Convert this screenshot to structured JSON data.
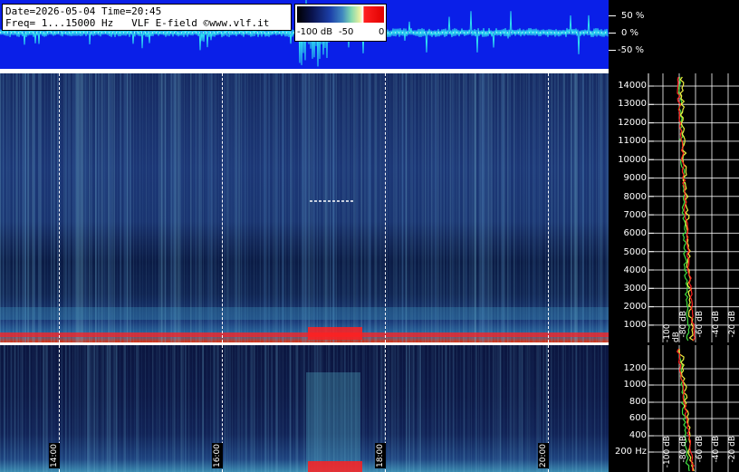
{
  "header": {
    "date_time": "Date=2026-05-04 Time=20:45",
    "freq": "Freq= 1...15000 Hz   VLF E-field ©www.vlf.it"
  },
  "colorbar": {
    "ticks": [
      "-100 dB",
      "-50",
      "0"
    ]
  },
  "waveform_scale": [
    "50 %",
    "0 %",
    "-50 %"
  ],
  "time_axis": [
    "14:00",
    "16:00",
    "18:00",
    "20:00"
  ],
  "top_panel": {
    "freq_labels": [
      "14000",
      "13000",
      "12000",
      "11000",
      "10000",
      "9000",
      "8000",
      "7000",
      "6000",
      "5000",
      "4000",
      "3000",
      "2000",
      "1000"
    ],
    "db_labels": [
      "-100 dB",
      "-80 dB",
      "-60 dB",
      "-40 dB",
      "-20 dB"
    ]
  },
  "bottom_panel": {
    "freq_labels": [
      "1200",
      "1000",
      "800",
      "600",
      "400",
      "200 Hz"
    ],
    "db_labels": [
      "-100 dB",
      "-80 dB",
      "-60 dB",
      "-40 dB",
      "-20 dB"
    ]
  },
  "colors": {
    "wave_bg": "#0a1fe8",
    "wave_trace": "#2fe0f0",
    "trace_red": "#ff2020",
    "trace_green": "#40e040",
    "trace_yellow": "#f0f040"
  }
}
